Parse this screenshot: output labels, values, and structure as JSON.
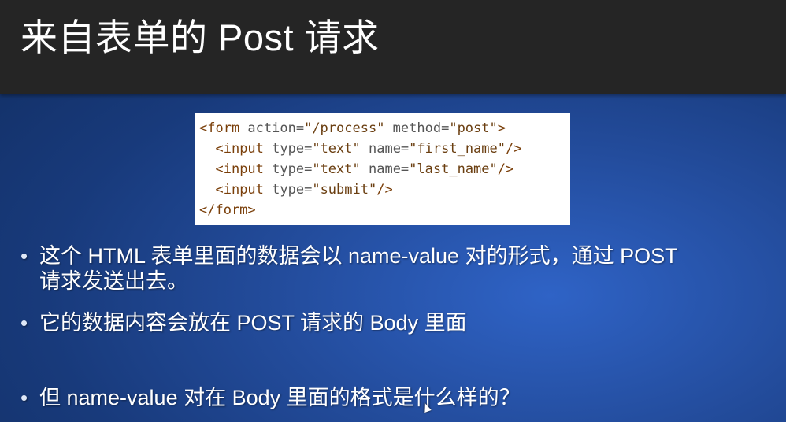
{
  "slide": {
    "title": "来自表单的 Post 请求",
    "code_lines": [
      {
        "tag_open": "<form",
        "a1": " action=",
        "v1": "\"/process\"",
        "a2": " method=",
        "v2": "\"post\"",
        "tail": ">"
      },
      {
        "indent": "  ",
        "tag_open": "<input",
        "a1": " type=",
        "v1": "\"text\"",
        "a2": " name=",
        "v2": "\"first_name\"",
        "tail": "/>"
      },
      {
        "indent": "  ",
        "tag_open": "<input",
        "a1": " type=",
        "v1": "\"text\"",
        "a2": " name=",
        "v2": "\"last_name\"",
        "tail": "/>"
      },
      {
        "indent": "  ",
        "tag_open": "<input",
        "a1": " type=",
        "v1": "\"submit\"",
        "a2": "",
        "v2": "",
        "tail": "/>"
      },
      {
        "tag_open": "</form>",
        "a1": "",
        "v1": "",
        "a2": "",
        "v2": "",
        "tail": ""
      }
    ],
    "bullets": [
      {
        "line1": "这个 HTML 表单里面的数据会以 name-value 对的形式，通过 POST",
        "line2": "请求发送出去。"
      },
      {
        "line1": "它的数据内容会放在 POST 请求的 Body 里面"
      },
      {
        "line1": "但 name-value 对在 Body 里面的格式是什么样的？"
      }
    ],
    "bullet_symbol": "•"
  }
}
